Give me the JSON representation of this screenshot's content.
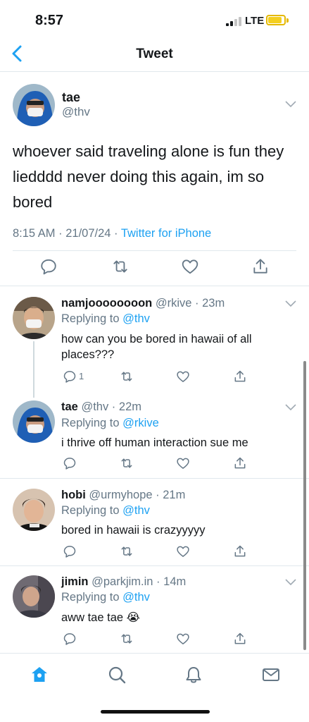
{
  "status_bar": {
    "time": "8:57",
    "network": "LTE",
    "battery_color": "#f4cf1f"
  },
  "nav": {
    "back_icon": "chevron-left-icon",
    "title": "Tweet"
  },
  "main_tweet": {
    "name": "tae",
    "handle": "@thv",
    "text": "whoever said traveling alone is fun they liedddd never doing this again, im so bored",
    "time": "8:15 AM",
    "date": "21/07/24",
    "source": "Twitter for iPhone",
    "actions": [
      "reply-icon",
      "retweet-icon",
      "like-icon",
      "share-icon"
    ]
  },
  "replies": [
    {
      "name": "namjoooooooon",
      "handle": "@rkive",
      "time": "23m",
      "replying_label": "Replying to",
      "replying_to": "@thv",
      "text": "how can you be bored in hawaii of all places???",
      "reply_count": "1"
    },
    {
      "name": "tae",
      "handle": "@thv",
      "time": "22m",
      "replying_label": "Replying to",
      "replying_to": "@rkive",
      "text": "i thrive off human interaction sue me"
    },
    {
      "name": "hobi",
      "handle": "@urmyhope",
      "time": "21m",
      "replying_label": "Replying to",
      "replying_to": "@thv",
      "text": "bored in hawaii is crazyyyyy"
    },
    {
      "name": "jimin",
      "handle": "@parkjim.in",
      "time": "14m",
      "replying_label": "Replying to",
      "replying_to": "@thv",
      "text": "aww tae tae 😭"
    }
  ],
  "separators": {
    "dot": " · "
  },
  "tab_bar": {
    "tabs": [
      "home-icon",
      "search-icon",
      "notifications-icon",
      "messages-icon"
    ],
    "active": "home-icon"
  },
  "colors": {
    "accent": "#1da1f2",
    "secondary_text": "#657786",
    "divider": "#e1e8ed"
  }
}
